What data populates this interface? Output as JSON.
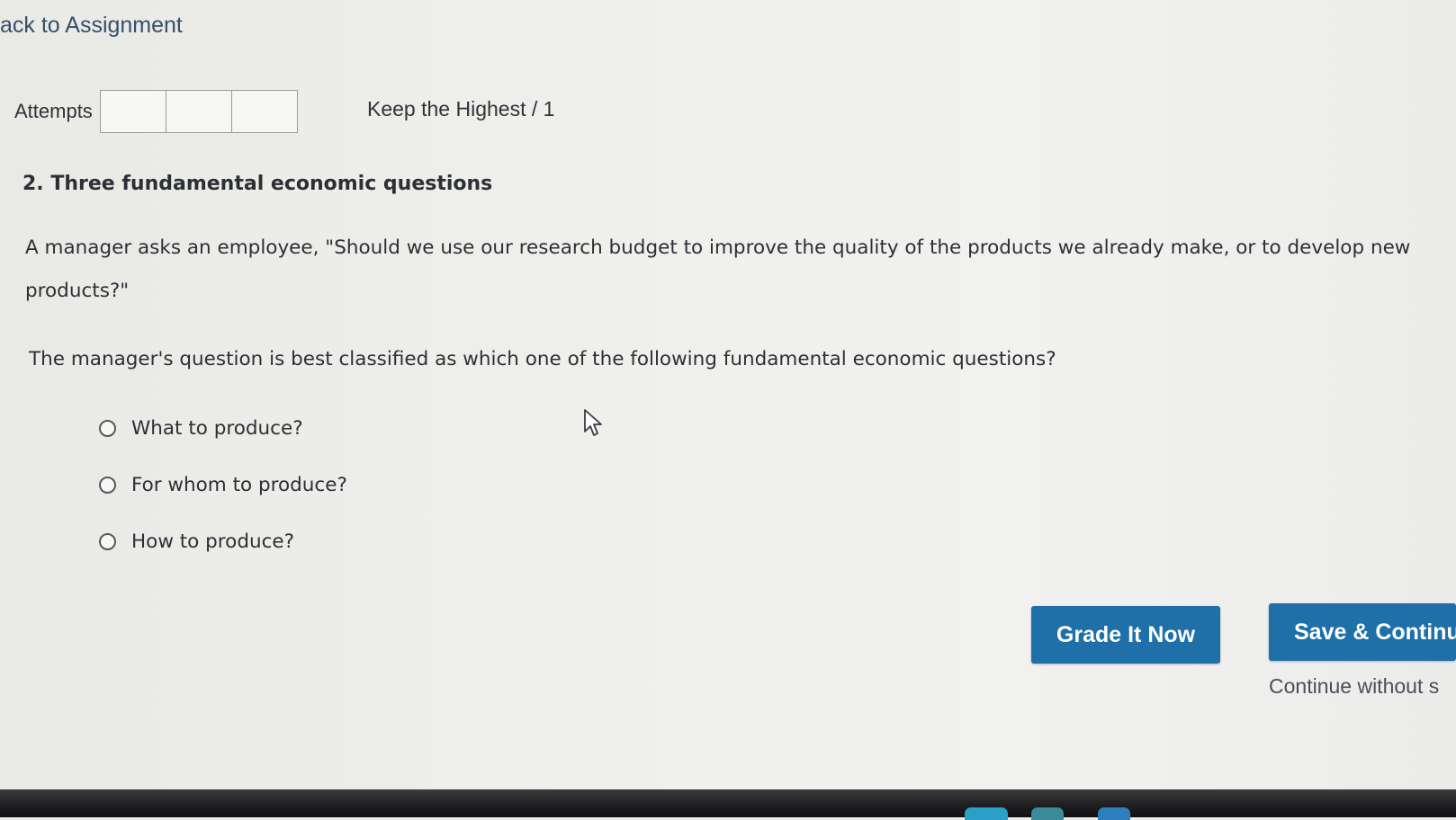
{
  "nav": {
    "back_label": "ack to Assignment"
  },
  "attempts": {
    "label": "Attempts",
    "box_count": 3,
    "policy": "Keep the Highest / 1"
  },
  "question": {
    "title": "2. Three fundamental economic questions",
    "prompt": "A manager asks an employee, \"Should we use our research budget to improve the quality of the products we already make, or to develop new products?\"",
    "text": "The manager's question is best classified as which one of the following fundamental economic questions?",
    "options": [
      {
        "label": "What to produce?",
        "selected": false
      },
      {
        "label": "For whom to produce?",
        "selected": false
      },
      {
        "label": "How to produce?",
        "selected": false
      }
    ]
  },
  "actions": {
    "grade_label": "Grade It Now",
    "save_label": "Save & Continu",
    "continue_label": "Continue without s"
  },
  "colors": {
    "button_blue": "#1f6fa8",
    "link_blue": "#36506a"
  },
  "icons": {
    "cursor": "arrow-cursor-icon",
    "radio": "radio-unchecked-icon"
  }
}
